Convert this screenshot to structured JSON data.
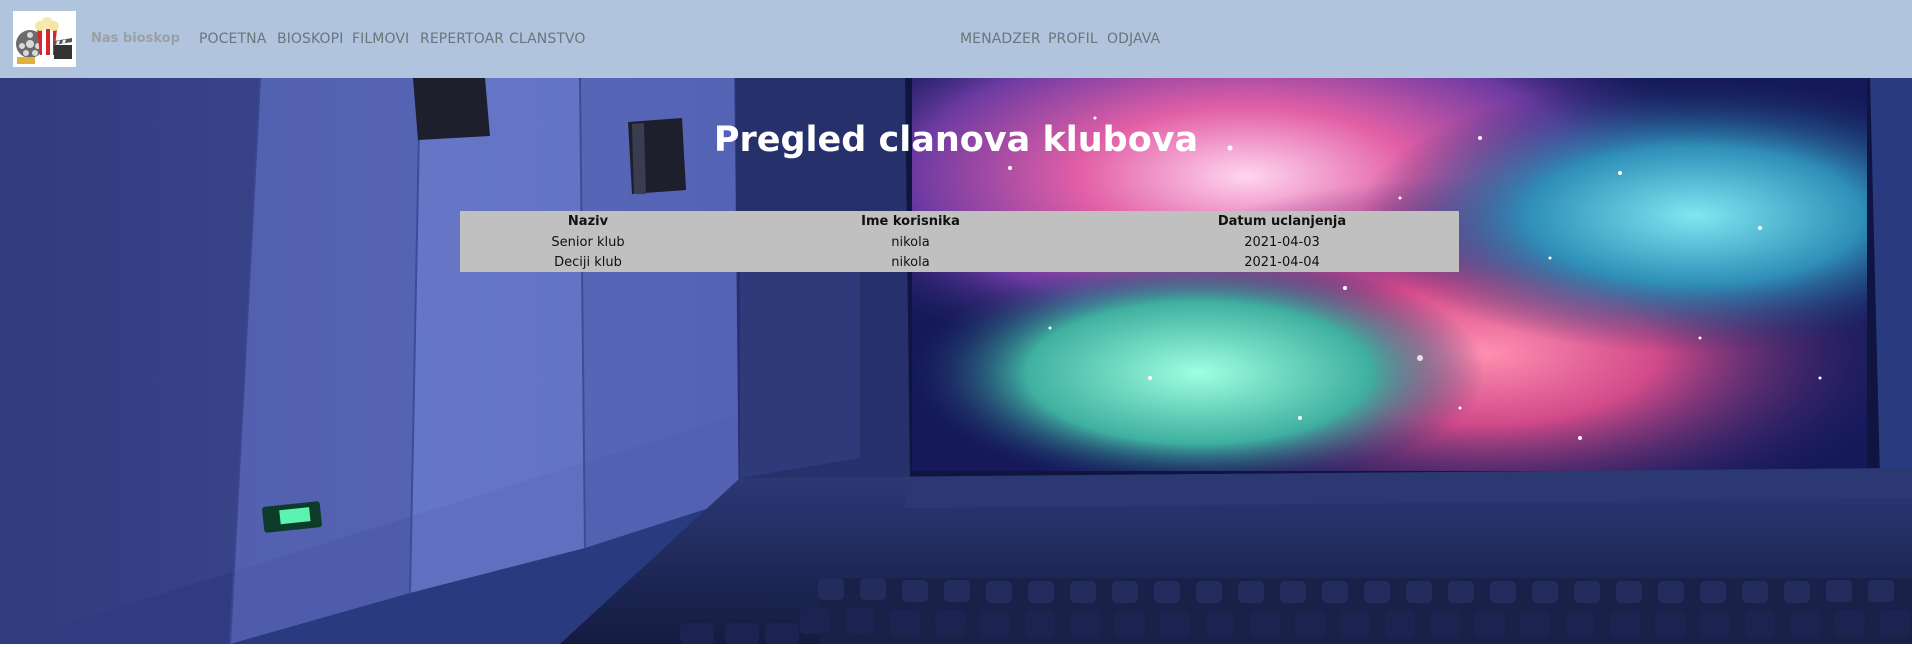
{
  "nav": {
    "brand": "Nas bioskop",
    "left_links": [
      {
        "label": "POCETNA"
      },
      {
        "label": "BIOSKOPI"
      },
      {
        "label": "FILMOVI"
      },
      {
        "label": "REPERTOAR"
      },
      {
        "label": "CLANSTVO"
      }
    ],
    "right_links": [
      {
        "label": "MENADZER"
      },
      {
        "label": "PROFIL"
      },
      {
        "label": "ODJAVA"
      }
    ]
  },
  "main": {
    "title": "Pregled clanova klubova",
    "table": {
      "headers": [
        "Naziv",
        "Ime korisnika",
        "Datum uclanjenja"
      ],
      "rows": [
        [
          "Senior klub",
          "nikola",
          "2021-04-03"
        ],
        [
          "Deciji klub",
          "nikola",
          "2021-04-04"
        ]
      ]
    }
  },
  "colors": {
    "navbar_bg": "#b0c4de",
    "table_bg": "#c0c0c0",
    "title": "#ffffff"
  },
  "icons": [
    "cinema-logo-icon",
    "exit-sign-icon"
  ]
}
